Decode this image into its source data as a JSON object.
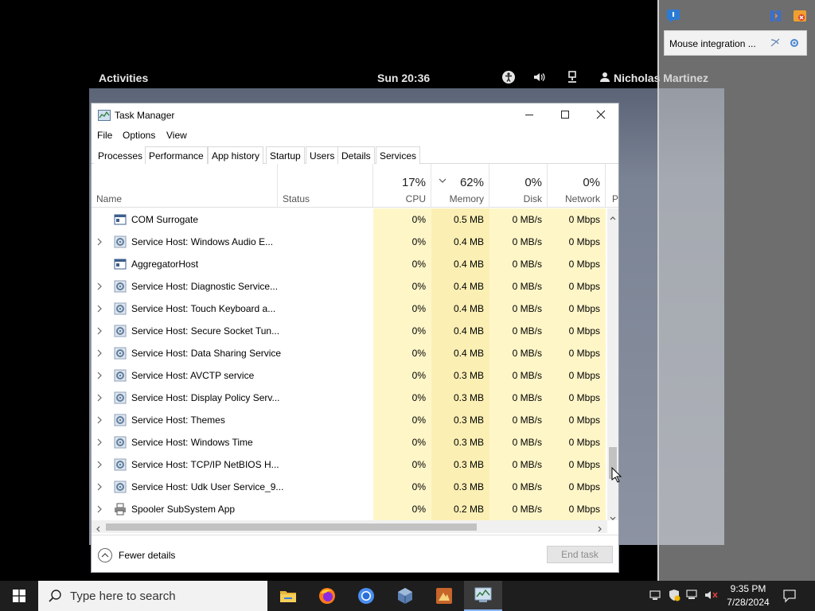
{
  "gnome_bar": {
    "activities": "Activities",
    "clock": "Sun 20:36",
    "user": "Nicholas Martinez"
  },
  "vbox": {
    "notification": "Mouse integration ..."
  },
  "window": {
    "title": "Task Manager",
    "menu": [
      "File",
      "Options",
      "View"
    ],
    "tabs": [
      "Processes",
      "Performance",
      "App history",
      "Startup",
      "Users",
      "Details",
      "Services"
    ],
    "active_tab": "Processes"
  },
  "columns": {
    "name": "Name",
    "status": "Status",
    "cpu": {
      "pct": "17%",
      "label": "CPU"
    },
    "memory": {
      "pct": "62%",
      "label": "Memory"
    },
    "disk": {
      "pct": "0%",
      "label": "Disk"
    },
    "network": {
      "pct": "0%",
      "label": "Network"
    },
    "power": "P"
  },
  "processes": [
    {
      "name": "COM Surrogate",
      "expandable": false,
      "icon": "window-icon",
      "cpu": "0%",
      "memory": "0.5 MB",
      "disk": "0 MB/s",
      "network": "0 Mbps"
    },
    {
      "name": "Service Host: Windows Audio E...",
      "expandable": true,
      "icon": "gear-icon",
      "cpu": "0%",
      "memory": "0.4 MB",
      "disk": "0 MB/s",
      "network": "0 Mbps"
    },
    {
      "name": "AggregatorHost",
      "expandable": false,
      "icon": "window-icon",
      "cpu": "0%",
      "memory": "0.4 MB",
      "disk": "0 MB/s",
      "network": "0 Mbps"
    },
    {
      "name": "Service Host: Diagnostic Service...",
      "expandable": true,
      "icon": "gear-icon",
      "cpu": "0%",
      "memory": "0.4 MB",
      "disk": "0 MB/s",
      "network": "0 Mbps"
    },
    {
      "name": "Service Host: Touch Keyboard a...",
      "expandable": true,
      "icon": "gear-icon",
      "cpu": "0%",
      "memory": "0.4 MB",
      "disk": "0 MB/s",
      "network": "0 Mbps"
    },
    {
      "name": "Service Host: Secure Socket Tun...",
      "expandable": true,
      "icon": "gear-icon",
      "cpu": "0%",
      "memory": "0.4 MB",
      "disk": "0 MB/s",
      "network": "0 Mbps"
    },
    {
      "name": "Service Host: Data Sharing Service",
      "expandable": true,
      "icon": "gear-icon",
      "cpu": "0%",
      "memory": "0.4 MB",
      "disk": "0 MB/s",
      "network": "0 Mbps"
    },
    {
      "name": "Service Host: AVCTP service",
      "expandable": true,
      "icon": "gear-icon",
      "cpu": "0%",
      "memory": "0.3 MB",
      "disk": "0 MB/s",
      "network": "0 Mbps"
    },
    {
      "name": "Service Host: Display Policy Serv...",
      "expandable": true,
      "icon": "gear-icon",
      "cpu": "0%",
      "memory": "0.3 MB",
      "disk": "0 MB/s",
      "network": "0 Mbps"
    },
    {
      "name": "Service Host: Themes",
      "expandable": true,
      "icon": "gear-icon",
      "cpu": "0%",
      "memory": "0.3 MB",
      "disk": "0 MB/s",
      "network": "0 Mbps"
    },
    {
      "name": "Service Host: Windows Time",
      "expandable": true,
      "icon": "gear-icon",
      "cpu": "0%",
      "memory": "0.3 MB",
      "disk": "0 MB/s",
      "network": "0 Mbps"
    },
    {
      "name": "Service Host: TCP/IP NetBIOS H...",
      "expandable": true,
      "icon": "gear-icon",
      "cpu": "0%",
      "memory": "0.3 MB",
      "disk": "0 MB/s",
      "network": "0 Mbps"
    },
    {
      "name": "Service Host: Udk User Service_9...",
      "expandable": true,
      "icon": "gear-icon",
      "cpu": "0%",
      "memory": "0.3 MB",
      "disk": "0 MB/s",
      "network": "0 Mbps"
    },
    {
      "name": "Spooler SubSystem App",
      "expandable": true,
      "icon": "printer-icon",
      "cpu": "0%",
      "memory": "0.2 MB",
      "disk": "0 MB/s",
      "network": "0 Mbps"
    }
  ],
  "footer": {
    "fewer_details": "Fewer details",
    "end_task": "End task"
  },
  "taskbar": {
    "search_placeholder": "Type here to search",
    "time": "9:35 PM",
    "date": "7/28/2024",
    "apps": [
      "file-explorer-icon",
      "firefox-icon",
      "chrome-icon",
      "virtualbox-icon",
      "app-icon",
      "task-manager-icon"
    ],
    "active_app": "task-manager-icon"
  },
  "colors": {
    "cpu_col_bg": "#fff6c8",
    "memory_col_bg": "#fcefb4",
    "taskbar_bg": "#1e1e1e"
  }
}
